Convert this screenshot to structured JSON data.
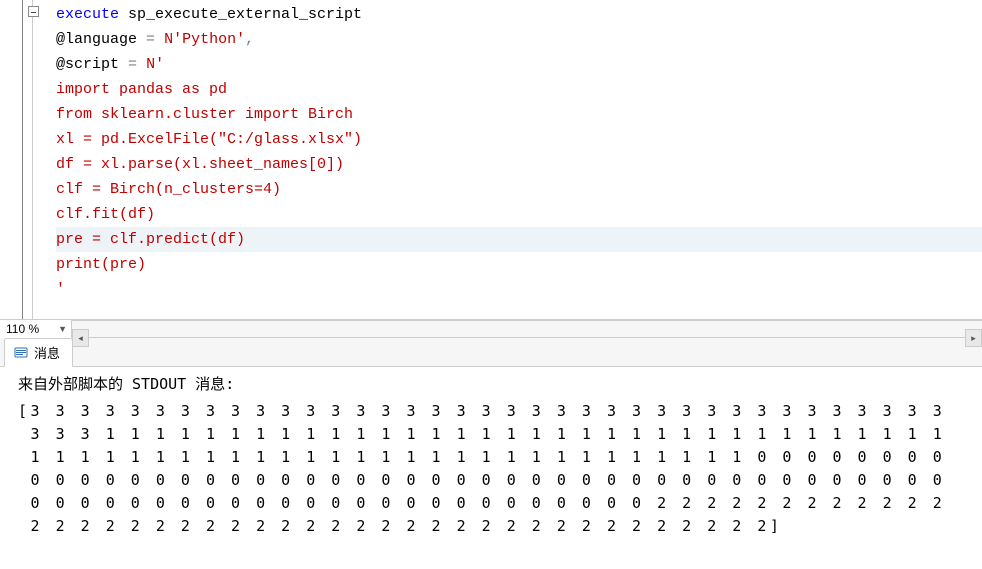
{
  "editor": {
    "lines": [
      [
        {
          "t": "execute",
          "c": "k-blue"
        },
        {
          "t": " sp_execute_external_script",
          "c": "k-black"
        }
      ],
      [
        {
          "t": "@language",
          "c": "k-black"
        },
        {
          "t": " ",
          "c": "k-gray"
        },
        {
          "t": "=",
          "c": "k-gray"
        },
        {
          "t": " ",
          "c": "k-gray"
        },
        {
          "t": "N'Python'",
          "c": "k-red"
        },
        {
          "t": ",",
          "c": "k-gray"
        }
      ],
      [
        {
          "t": "@script",
          "c": "k-black"
        },
        {
          "t": " ",
          "c": "k-gray"
        },
        {
          "t": "=",
          "c": "k-gray"
        },
        {
          "t": " ",
          "c": "k-gray"
        },
        {
          "t": "N'",
          "c": "k-red"
        }
      ],
      [
        {
          "t": "import pandas as pd",
          "c": "k-red"
        }
      ],
      [
        {
          "t": "from sklearn.cluster import Birch",
          "c": "k-red"
        }
      ],
      [
        {
          "t": "xl = pd.ExcelFile(\"C:/glass.xlsx\")",
          "c": "k-red"
        }
      ],
      [
        {
          "t": "df = xl.parse(xl.sheet_names[0])",
          "c": "k-red"
        }
      ],
      [
        {
          "t": "clf = Birch(n_clusters=4)",
          "c": "k-red"
        }
      ],
      [
        {
          "t": "clf.fit(df)",
          "c": "k-red"
        }
      ],
      [
        {
          "t": "pre = clf.predict(df)",
          "c": "k-red"
        }
      ],
      [
        {
          "t": "print(pre)",
          "c": "k-red"
        }
      ],
      [
        {
          "t": "'",
          "c": "k-red"
        }
      ]
    ],
    "highlight_line_index": 9
  },
  "zoom": {
    "level": "110 %"
  },
  "tabs": {
    "messages_label": "消息",
    "messages_icon": "messages-icon"
  },
  "results": {
    "header": "来自外部脚本的 STDOUT 消息:",
    "rows": [
      "[3 3 3 3 3 3 3 3 3 3 3 3 3 3 3 3 3 3 3 3 3 3 3 3 3 3 3 3 3 3 3 3 3 3 3 3 3",
      " 3 3 3 1 1 1 1 1 1 1 1 1 1 1 1 1 1 1 1 1 1 1 1 1 1 1 1 1 1 1 1 1 1 1 1 1 1",
      " 1 1 1 1 1 1 1 1 1 1 1 1 1 1 1 1 1 1 1 1 1 1 1 1 1 1 1 1 1 0 0 0 0 0 0 0 0",
      " 0 0 0 0 0 0 0 0 0 0 0 0 0 0 0 0 0 0 0 0 0 0 0 0 0 0 0 0 0 0 0 0 0 0 0 0 0",
      " 0 0 0 0 0 0 0 0 0 0 0 0 0 0 0 0 0 0 0 0 0 0 0 0 0 2 2 2 2 2 2 2 2 2 2 2 2",
      " 2 2 2 2 2 2 2 2 2 2 2 2 2 2 2 2 2 2 2 2 2 2 2 2 2 2 2 2 2 2]"
    ]
  }
}
